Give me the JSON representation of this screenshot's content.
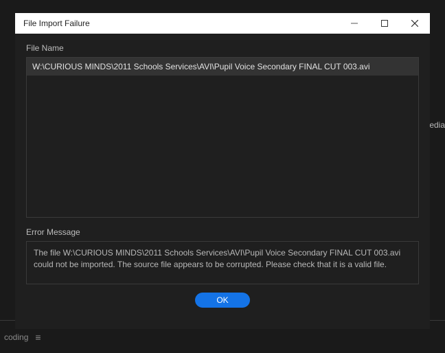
{
  "background": {
    "right_clipped_text": "edia",
    "bottom_left_text": "coding"
  },
  "dialog": {
    "title": "File Import Failure",
    "file_name_label": "File Name",
    "file_entry": "W:\\CURIOUS MINDS\\2011 Schools Services\\AVI\\Pupil Voice Secondary FINAL CUT 003.avi",
    "error_label": "Error Message",
    "error_text": "The file W:\\CURIOUS MINDS\\2011 Schools Services\\AVI\\Pupil Voice Secondary FINAL CUT 003.avi could not be imported. The source file appears to be corrupted. Please check that it is a valid file.",
    "ok_label": "OK"
  }
}
